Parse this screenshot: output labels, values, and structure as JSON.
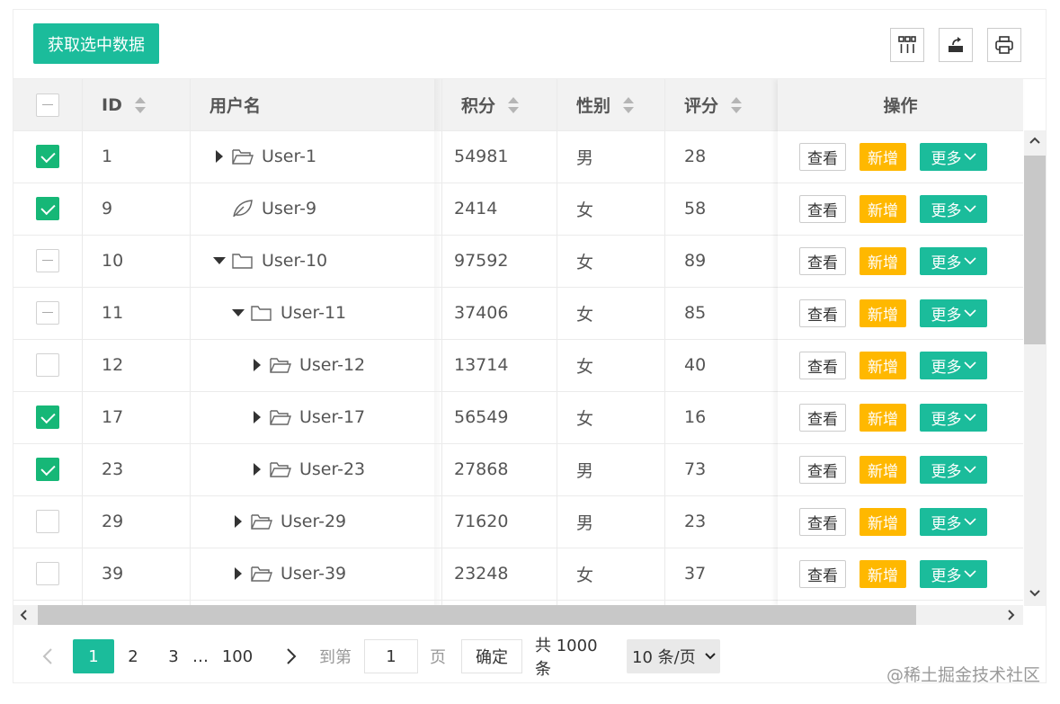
{
  "toolbar": {
    "get_selected_label": "获取选中数据",
    "icons": [
      "columns-icon",
      "export-icon",
      "print-icon"
    ]
  },
  "columns": {
    "id": "ID",
    "username": "用户名",
    "score": "积分",
    "gender": "性别",
    "rating": "评分",
    "actions": "操作"
  },
  "rows": [
    {
      "id": "1",
      "username": "User-1",
      "score": "54981",
      "gender": "男",
      "rating": "28",
      "checked": "checked",
      "level": 0,
      "node": "collapsed-folder"
    },
    {
      "id": "9",
      "username": "User-9",
      "score": "2414",
      "gender": "女",
      "rating": "58",
      "checked": "checked",
      "level": 0,
      "node": "leaf"
    },
    {
      "id": "10",
      "username": "User-10",
      "score": "97592",
      "gender": "女",
      "rating": "89",
      "checked": "partial",
      "level": 0,
      "node": "expanded-folder"
    },
    {
      "id": "11",
      "username": "User-11",
      "score": "37406",
      "gender": "女",
      "rating": "85",
      "checked": "partial",
      "level": 1,
      "node": "expanded-folder"
    },
    {
      "id": "12",
      "username": "User-12",
      "score": "13714",
      "gender": "女",
      "rating": "40",
      "checked": "unchecked",
      "level": 2,
      "node": "collapsed-folder"
    },
    {
      "id": "17",
      "username": "User-17",
      "score": "56549",
      "gender": "女",
      "rating": "16",
      "checked": "checked",
      "level": 2,
      "node": "collapsed-folder"
    },
    {
      "id": "23",
      "username": "User-23",
      "score": "27868",
      "gender": "男",
      "rating": "73",
      "checked": "checked",
      "level": 2,
      "node": "collapsed-folder"
    },
    {
      "id": "29",
      "username": "User-29",
      "score": "71620",
      "gender": "男",
      "rating": "23",
      "checked": "unchecked",
      "level": 1,
      "node": "collapsed-folder"
    },
    {
      "id": "39",
      "username": "User-39",
      "score": "23248",
      "gender": "女",
      "rating": "37",
      "checked": "unchecked",
      "level": 1,
      "node": "collapsed-folder"
    }
  ],
  "row_actions": {
    "view": "查看",
    "add": "新增",
    "more": "更多"
  },
  "pagination": {
    "pages": [
      "1",
      "2",
      "3"
    ],
    "ellipsis": "…",
    "last_page": "100",
    "current": "1",
    "goto_prefix": "到第",
    "goto_value": "1",
    "goto_suffix": "页",
    "confirm": "确定",
    "total": "共 1000 条",
    "page_size": "10 条/页"
  },
  "watermark": "@稀土掘金技术社区",
  "colors": {
    "accent": "#1bbc9b",
    "warning": "#ffb800",
    "checkbox": "#16b777"
  }
}
